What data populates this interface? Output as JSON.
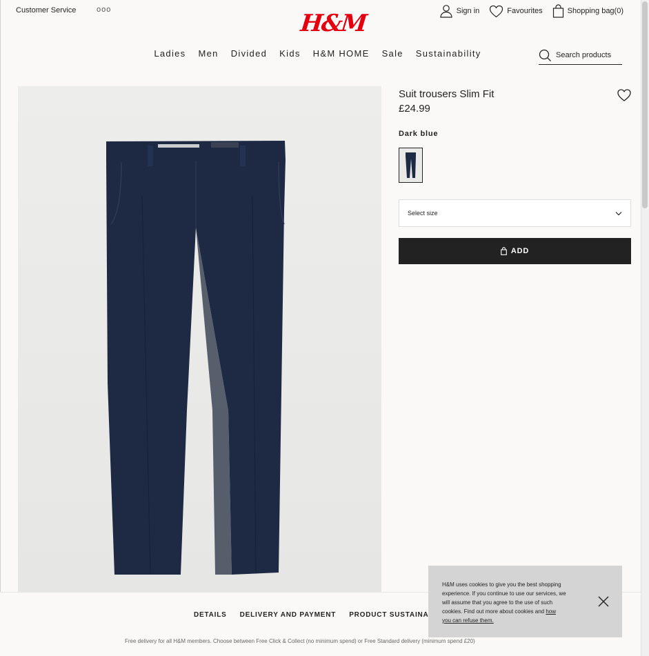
{
  "header": {
    "customer_service": "Customer Service",
    "more": "ooo",
    "logo": "H&M",
    "sign_in": "Sign in",
    "favourites": "Favourites",
    "shopping_bag": "Shopping bag(0)"
  },
  "nav": {
    "items": [
      "Ladies",
      "Men",
      "Divided",
      "Kids",
      "H&M HOME",
      "Sale",
      "Sustainability"
    ]
  },
  "search": {
    "placeholder": "Search products"
  },
  "product": {
    "title": "Suit trousers Slim Fit",
    "price": "£24.99",
    "color": "Dark blue",
    "size_placeholder": "Select size",
    "add_label": "ADD"
  },
  "tabs": [
    "DETAILS",
    "DELIVERY AND PAYMENT",
    "PRODUCT SUSTAINABI"
  ],
  "footer": {
    "free_delivery": "Free delivery for all H&M members. Choose between Free Click & Collect (no minimum spend) or Free Standard delivery (minimum spend £20)"
  },
  "cookie": {
    "text": "H&M uses cookies to give you the best shopping experience. If you continue to use our services, we will assume that you agree to the use of such cookies. Find out more about cookies and ",
    "link": "how you can refuse them."
  },
  "colors": {
    "brand_red": "#e50010",
    "trouser_navy": "#1e2a44",
    "button_black": "#222222"
  },
  "icons": [
    "person-icon",
    "heart-icon",
    "bag-icon",
    "search-icon",
    "chevron-down-icon",
    "close-icon"
  ]
}
